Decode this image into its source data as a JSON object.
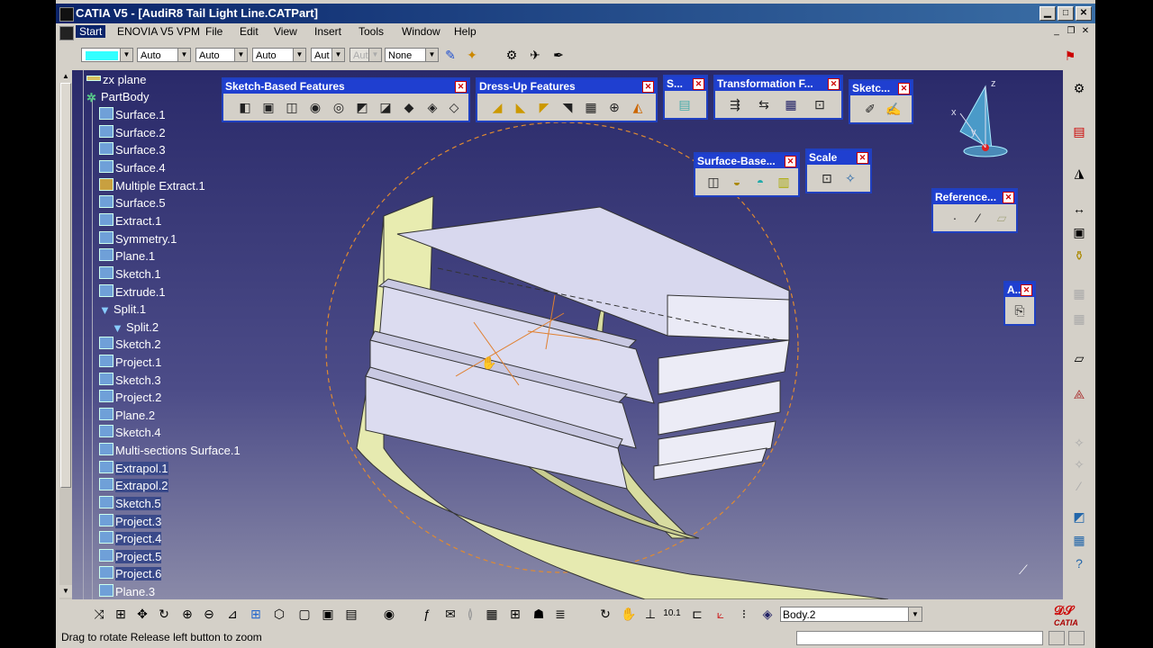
{
  "window": {
    "title": "CATIA V5 - [AudiR8 Tail Light Line.CATPart]"
  },
  "menu": {
    "items": [
      "Start",
      "ENOVIA V5 VPM",
      "File",
      "Edit",
      "View",
      "Insert",
      "Tools",
      "Window",
      "Help"
    ]
  },
  "toolbar": {
    "combo_1": "Auto",
    "combo_2": "Auto",
    "combo_3": "Auto",
    "combo_4": "Aut",
    "combo_5_disabled": "Aut",
    "combo_6": "None",
    "swatch_color": "#33ffff"
  },
  "tree": {
    "nodes": [
      "zx plane",
      "PartBody",
      "Surface.1",
      "Surface.2",
      "Surface.3",
      "Surface.4",
      "Multiple Extract.1",
      "Surface.5",
      "Extract.1",
      "Symmetry.1",
      "Plane.1",
      "Sketch.1",
      "Extrude.1",
      "Split.1",
      "Split.2",
      "Sketch.2",
      "Project.1",
      "Sketch.3",
      "Project.2",
      "Plane.2",
      "Sketch.4",
      "Multi-sections Surface.1",
      "Extrapol.1",
      "Extrapol.2",
      "Sketch.5",
      "Project.3",
      "Project.4",
      "Project.5",
      "Project.6",
      "Plane.3"
    ]
  },
  "panels": {
    "sketch_based": {
      "title": "Sketch-Based Features"
    },
    "dress_up": {
      "title": "Dress-Up Features"
    },
    "s": {
      "title": "S..."
    },
    "transformation": {
      "title": "Transformation F..."
    },
    "sketch": {
      "title": "Sketc..."
    },
    "surface_based": {
      "title": "Surface-Base..."
    },
    "scale": {
      "title": "Scale"
    },
    "reference": {
      "title": "Reference..."
    },
    "a": {
      "title": "A.."
    }
  },
  "compass": {
    "x": "x",
    "y": "y",
    "z": "z"
  },
  "bottom": {
    "body_select": "Body.2"
  },
  "status": {
    "text": "Drag to rotate  Release left button to zoom"
  },
  "logo": {
    "text": "CATIA"
  }
}
